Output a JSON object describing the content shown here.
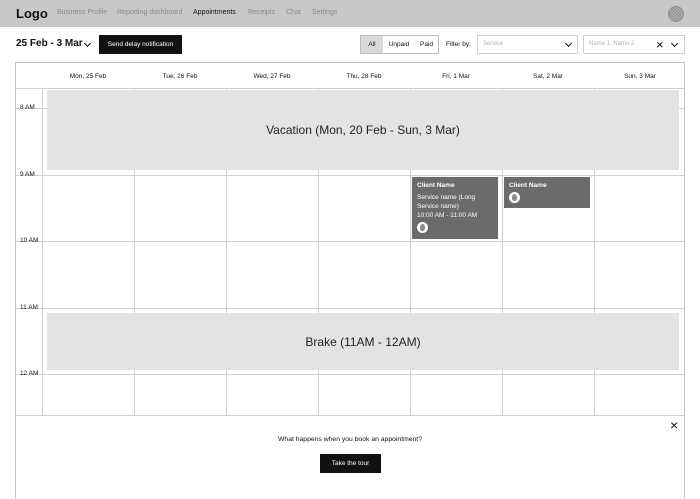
{
  "nav": {
    "logo": "Logo",
    "links": [
      "Business Profile",
      "Reporting dashboard",
      "Appointments",
      "Receipts",
      "Chat",
      "Settings"
    ],
    "active": "Appointments",
    "avatar_icon": "user-avatar-icon"
  },
  "toolbar": {
    "date_range": "25 Feb - 3 Mar",
    "delay_button": "Send delay notification",
    "segments": [
      "All",
      "Unpaid",
      "Paid"
    ],
    "segment_selected": "All",
    "filter_label": "Filter by:",
    "service_placeholder": "Service",
    "names_placeholder": "Name 1, Name 2"
  },
  "calendar": {
    "days": [
      "Mon, 25 Feb",
      "Tue, 26 Feb",
      "Wed, 27 Feb",
      "Thu, 28 Feb",
      "Fri, 1 Mar",
      "Sat, 2 Mar",
      "Sun, 3 Mar"
    ],
    "hours": [
      "8 AM",
      "9 AM",
      "10 AM",
      "11 AM",
      "12 AM"
    ],
    "vacation_label": "Vacation (Mon, 20 Feb - Sun, 3 Mar)",
    "brake_label": "Brake (11AM - 12AM)",
    "appointments": [
      {
        "client": "Client Name",
        "service": "Service name (Long Service name)",
        "time": "10:00 AM - 11:00 AM"
      },
      {
        "client": "Client Name"
      }
    ]
  },
  "banner": {
    "text": "What happens when you book an appointment?",
    "button": "Take the tour"
  },
  "colors": {
    "nav_bg": "#c8c8c8",
    "block_bg": "#e3e3e3",
    "appointment_bg": "#6b6b6b",
    "primary_button": "#111111"
  }
}
